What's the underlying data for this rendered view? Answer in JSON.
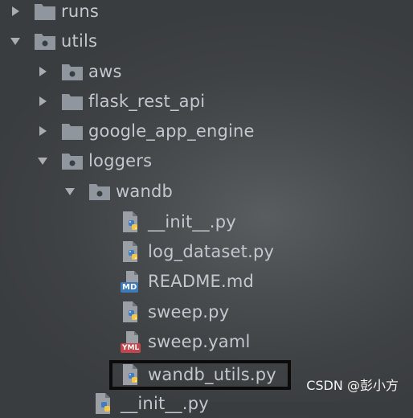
{
  "tree": {
    "items": [
      {
        "label": "runs",
        "icon": "folder-icon",
        "expanded": false
      },
      {
        "label": "utils",
        "icon": "package-folder-icon",
        "expanded": true
      },
      {
        "label": "aws",
        "icon": "package-folder-icon",
        "expanded": false
      },
      {
        "label": "flask_rest_api",
        "icon": "folder-icon",
        "expanded": false
      },
      {
        "label": "google_app_engine",
        "icon": "folder-icon",
        "expanded": false
      },
      {
        "label": "loggers",
        "icon": "package-folder-icon",
        "expanded": true
      },
      {
        "label": "wandb",
        "icon": "package-folder-icon",
        "expanded": true
      },
      {
        "label": "__init__.py",
        "icon": "python-file-icon"
      },
      {
        "label": "log_dataset.py",
        "icon": "python-file-icon"
      },
      {
        "label": "README.md",
        "icon": "markdown-file-icon",
        "badge": "MD"
      },
      {
        "label": "sweep.py",
        "icon": "python-file-icon"
      },
      {
        "label": "sweep.yaml",
        "icon": "yaml-file-icon",
        "badge": "YML"
      },
      {
        "label": "wandb_utils.py",
        "icon": "python-file-icon",
        "highlighted": true
      },
      {
        "label": "__init__.py",
        "icon": "python-file-icon"
      }
    ]
  },
  "watermark": "CSDN @彭小方",
  "colors": {
    "folder": "#8f969d",
    "text": "#c4c7cb",
    "highlight_border": "#0b0b0b",
    "python_blue": "#3f7cc4",
    "python_yellow": "#f3c84a"
  }
}
